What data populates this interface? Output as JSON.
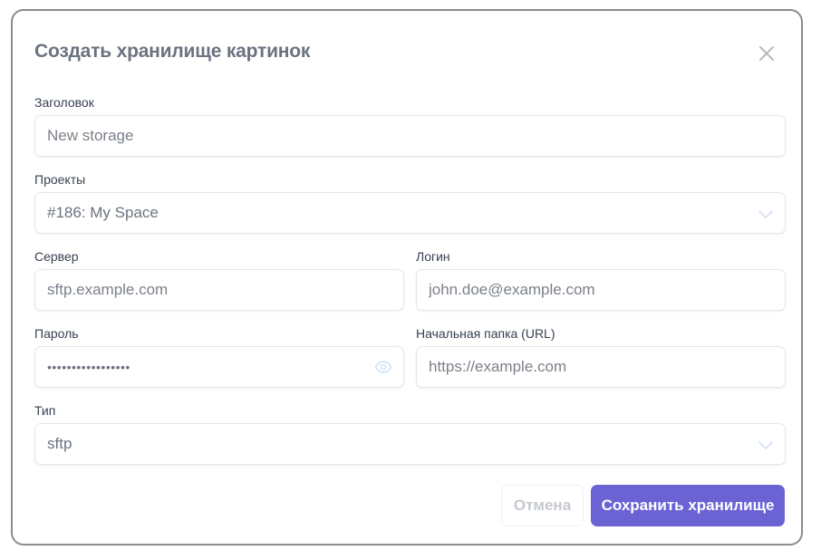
{
  "dialog": {
    "title": "Создать хранилище картинок",
    "close_icon": "close-icon"
  },
  "form": {
    "title_field": {
      "label": "Заголовок",
      "placeholder": "New storage",
      "value": ""
    },
    "projects": {
      "label": "Проекты",
      "value": "#186: My Space",
      "icon": "chevron-down-icon"
    },
    "server": {
      "label": "Сервер",
      "placeholder": "sftp.example.com",
      "value": ""
    },
    "login": {
      "label": "Логин",
      "placeholder": "john.doe@example.com",
      "value": ""
    },
    "password": {
      "label": "Пароль",
      "value": "•••••••••••••••••",
      "icon": "eye-icon"
    },
    "start_folder": {
      "label": "Начальная папка (URL)",
      "placeholder": "https://example.com",
      "value": ""
    },
    "type": {
      "label": "Тип",
      "value": "sftp",
      "icon": "chevron-down-icon"
    }
  },
  "actions": {
    "cancel_label": "Отмена",
    "save_label": "Сохранить хранилище"
  },
  "colors": {
    "primary": "#6b63d4",
    "border": "#e5e7eb",
    "title": "#6b7280",
    "label": "#374151",
    "icon_muted": "#cfe0f5"
  }
}
